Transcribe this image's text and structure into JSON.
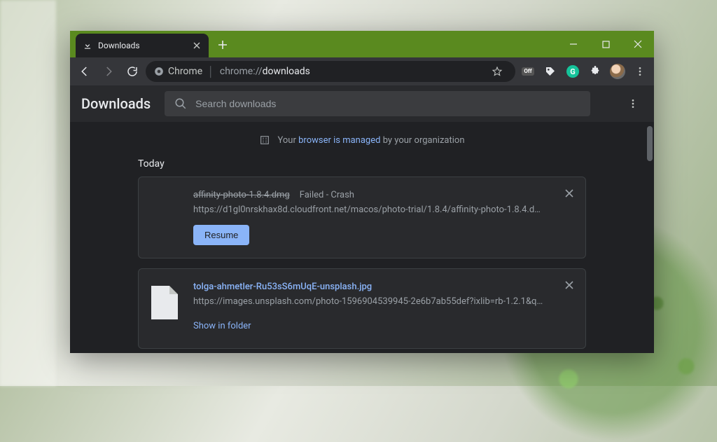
{
  "window": {
    "tab_title": "Downloads",
    "new_tab_tooltip": "New tab"
  },
  "toolbar": {
    "chrome_label": "Chrome",
    "url_scheme": "chrome://",
    "url_path": "downloads",
    "extensions": {
      "off_badge": "Off",
      "grammarly_letter": "G"
    }
  },
  "downloads": {
    "page_title": "Downloads",
    "search_placeholder": "Search downloads",
    "managed_prefix": "Your",
    "managed_link": "browser is managed",
    "managed_suffix": "by your organization",
    "section_today": "Today",
    "items": [
      {
        "filename": "affinity-photo-1.8.4.dmg",
        "status": "Failed - Crash",
        "source": "https://d1gl0nrskhax8d.cloudfront.net/macos/photo-trial/1.8.4/affinity-photo-1.8.4.d…",
        "action_primary": "Resume"
      },
      {
        "filename": "tolga-ahmetler-Ru53sS6mUqE-unsplash.jpg",
        "source": "https://images.unsplash.com/photo-1596904539945-2e6b7ab55def?ixlib=rb-1.2.1&q…",
        "action_link": "Show in folder"
      }
    ]
  }
}
